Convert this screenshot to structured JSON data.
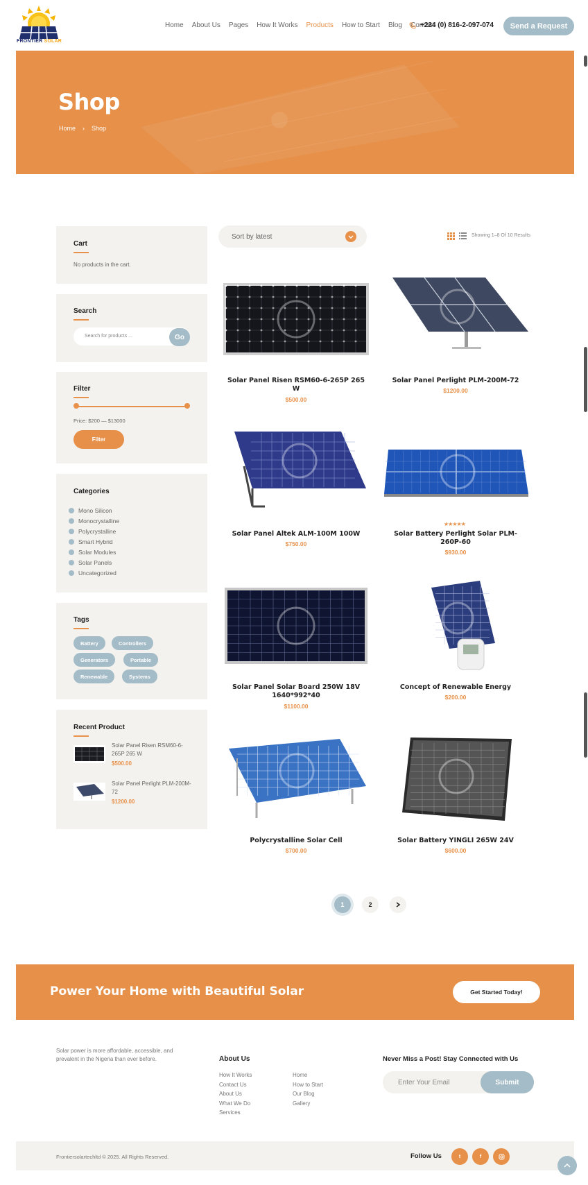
{
  "header": {
    "logo": {
      "line1": "FRONTIER",
      "line2": "SOLAR"
    },
    "nav": [
      "Home",
      "About Us",
      "Pages",
      "How It Works",
      "Products",
      "How to Start",
      "Blog",
      "Contact"
    ],
    "active_nav": "Products",
    "phone": "+234 (0) 816-2-097-074",
    "request_button": "Send a Request"
  },
  "hero": {
    "title": "Shop",
    "breadcrumb_home": "Home",
    "breadcrumb_sep": "›",
    "breadcrumb_current": "Shop"
  },
  "sidebar": {
    "cart": {
      "title": "Cart",
      "empty_text": "No products in the cart."
    },
    "search": {
      "title": "Search",
      "placeholder": "Search for products ...",
      "button": "Go"
    },
    "filter": {
      "title": "Filter",
      "price_text": "Price: $200 — $13000",
      "button": "Filter"
    },
    "categories": {
      "title": "Categories",
      "items": [
        "Mono Silicon",
        "Monocrystalline",
        "Polycrystalline",
        "Smart Hybrid",
        "Solar Modules",
        "Solar Panels",
        "Uncategorized"
      ]
    },
    "tags": {
      "title": "Tags",
      "items": [
        "Battery",
        "Controllers",
        "Generators",
        "Portable",
        "Renewable",
        "Systems"
      ]
    },
    "recent": {
      "title": "Recent Product",
      "items": [
        {
          "name": "Solar Panel Risen RSM60-6-265P 265 W",
          "price": "$500.00"
        },
        {
          "name": "Solar Panel Perlight PLM-200M-72",
          "price": "$1200.00"
        }
      ]
    }
  },
  "shop": {
    "sort": "Sort by latest",
    "showing": "Showing 1–8 Of 10 Results",
    "products": [
      {
        "name": "Solar Panel Risen RSM60-6-265P 265 W",
        "price": "$500.00"
      },
      {
        "name": "Solar Panel Perlight PLM-200M-72",
        "price": "$1200.00"
      },
      {
        "name": "Solar Panel Altek ALM-100M 100W",
        "price": "$750.00"
      },
      {
        "name": "Solar Battery Perlight Solar PLM-260P-60",
        "price": "$930.00",
        "rating": 5
      },
      {
        "name": "Solar Panel Solar Board 250W 18V 1640*992*40",
        "price": "$1100.00"
      },
      {
        "name": "Concept of Renewable Energy",
        "price": "$200.00"
      },
      {
        "name": "Polycrystalline Solar Cell",
        "price": "$700.00"
      },
      {
        "name": "Solar Battery YINGLI 265W 24V",
        "price": "$600.00"
      }
    ],
    "pages": [
      "1",
      "2"
    ],
    "current_page": "1"
  },
  "cta": {
    "title": "Power Your Home with Beautiful Solar",
    "button": "Get Started Today!"
  },
  "footer": {
    "about_text": "Solar power is more affordable, accessible, and prevalent in the Nigeria than ever before.",
    "about_title": "About Us",
    "links_col1": [
      "How It Works",
      "Contact Us",
      "About Us",
      "What We Do",
      "Services"
    ],
    "links_col2": [
      "Home",
      "How to Start",
      "Our Blog",
      "Gallery"
    ],
    "newsletter_title": "Never Miss a Post! Stay Connected with Us",
    "email_placeholder": "Enter Your Email",
    "submit": "Submit",
    "copyright": "Frontiersolartechltd © 2025. All Rights Reserved.",
    "follow": "Follow Us",
    "social": [
      "twitter-icon",
      "facebook-icon",
      "instagram-icon"
    ]
  },
  "colors": {
    "accent": "#e69049",
    "muted_blue": "#a3bcc7",
    "panel_bg": "#f3f2ee"
  }
}
